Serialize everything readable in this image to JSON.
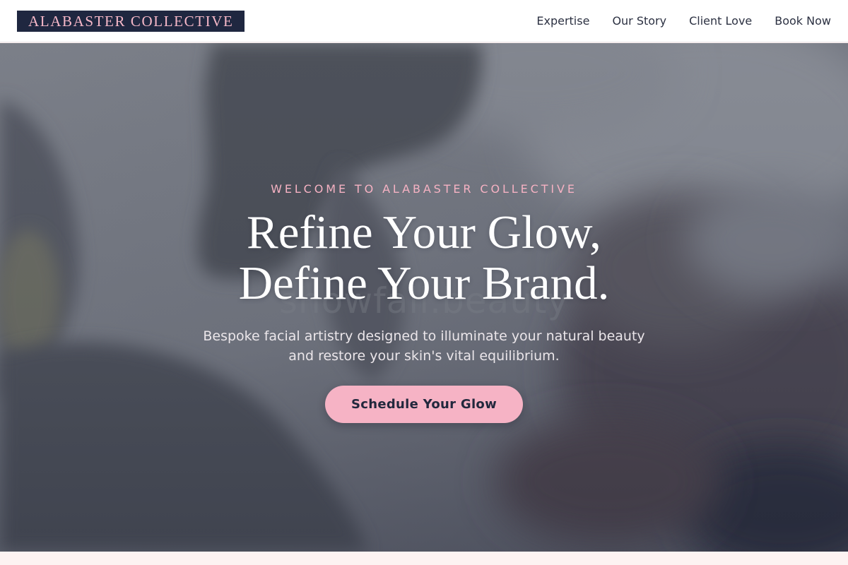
{
  "brand": {
    "name": "ALABASTER COLLECTIVE",
    "colors": {
      "navy": "#1f2740",
      "pink": "#f6b3c5",
      "cream": "#fdf3f2"
    }
  },
  "nav": {
    "items": [
      {
        "label": "Expertise"
      },
      {
        "label": "Our Story"
      },
      {
        "label": "Client Love"
      },
      {
        "label": "Book Now"
      }
    ]
  },
  "hero": {
    "eyebrow": "WELCOME TO ALABASTER COLLECTIVE",
    "headline_line1": "Refine Your Glow,",
    "headline_line2": "Define Your Brand.",
    "subtext_line1": "Bespoke facial artistry designed to illuminate your natural beauty",
    "subtext_line2": "and restore your skin's vital equilibrium.",
    "cta_label": "Schedule Your Glow",
    "watermark": "showfall.beauty",
    "background_image": "blurred-spa-facial-photo"
  }
}
